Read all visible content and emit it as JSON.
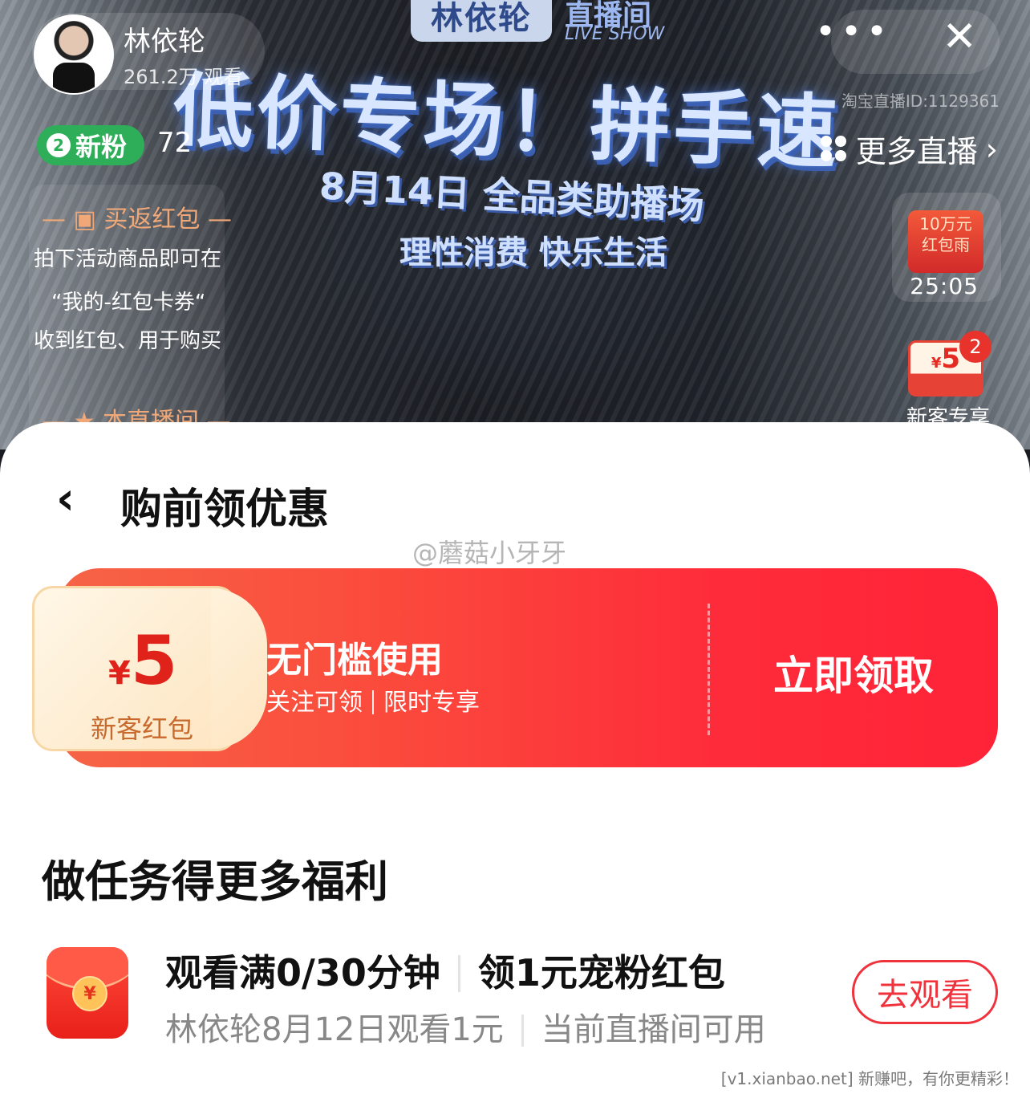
{
  "stream": {
    "brand_name": "林依轮",
    "brand_live": "直播间",
    "brand_live_sub": "LIVE SHOW",
    "headline": "低价专场！拼手速",
    "subline1": "8月14日 全品类助播场",
    "subline2": "理性消费 快乐生活",
    "room_id": "淘宝直播ID:1129361"
  },
  "host": {
    "name": "林依轮",
    "viewers": "261.2万 观看",
    "fans_level": "2",
    "fans_label": "新粉",
    "fans_count": "72"
  },
  "top_actions": {
    "more": "•••",
    "close": "✕"
  },
  "more_live": "更多直播",
  "left_panel": {
    "title": "买返红包",
    "lines": [
      "拍下活动商品即可在",
      "“我的-红包卡券“",
      "收到红包、用于购买"
    ],
    "title2": "本直播间"
  },
  "widgets": {
    "rain_line1": "10万元",
    "rain_line2": "红包雨",
    "rain_time": "25:05",
    "coupon_yen": "¥",
    "coupon_amount": "5",
    "coupon_badge": "2",
    "coupon_label": "新客专享"
  },
  "sheet": {
    "title": "购前领优惠",
    "watermark": "@蘑菇小牙牙"
  },
  "coupon": {
    "yen": "¥",
    "amount": "5",
    "label": "新客红包",
    "title": "无门槛使用",
    "sub1": "关注可领",
    "sub2": "限时专享",
    "claim": "立即领取"
  },
  "tasks": {
    "heading": "做任务得更多福利",
    "item": {
      "coin": "¥",
      "main_a": "观看满0/30分钟",
      "main_b": "领1元宠粉红包",
      "sub_a": "林依轮8月12日观看1元",
      "sub_b": "当前直播间可用",
      "button": "去观看"
    }
  },
  "footer_watermark": "[v1.xianbao.net] 新赚吧，有你更精彩！",
  "colors": {
    "accent_red": "#ff2338",
    "fans_green": "#2fae5a",
    "coupon_cream": "#fde5c1"
  }
}
